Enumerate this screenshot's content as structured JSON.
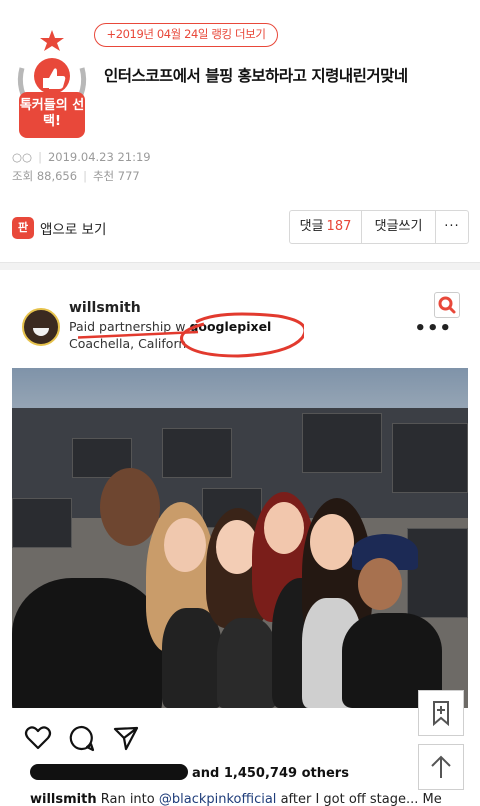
{
  "header": {
    "ranking_link": "+2019년 04월 24일 랭킹 더보기",
    "badge_label": "톡커들의 선택!",
    "title": "인터스코프에서 블핑 홍보하라고 지령내린거맞네"
  },
  "meta": {
    "date": "2019.04.23 21:19",
    "views_label": "조회",
    "views": "88,656",
    "recommend_label": "추천",
    "recommend": "777"
  },
  "toolbar": {
    "app_view_label": "앱으로 보기",
    "comment_label": "댓글",
    "comment_count": "187",
    "write_comment_label": "댓글쓰기",
    "more_label": "···"
  },
  "post": {
    "username": "willsmith",
    "partnership_prefix": "Paid partnership w",
    "partner": "googlepixel",
    "location": "Coachella, Californ",
    "more_label": "•••",
    "likes_suffix": "and 1,450,749 others",
    "caption_user": "willsmith",
    "caption_text_1": "Ran into",
    "caption_mention": "@blackpinkofficial",
    "caption_text_2": "after I got off stage... Me"
  },
  "icons": {
    "search": "search-icon",
    "heart": "heart-icon",
    "comment": "comment-icon",
    "share": "share-icon",
    "bookmark": "bookmark-icon",
    "scroll_top": "arrow-up-icon"
  },
  "colors": {
    "accent": "#e8483a",
    "mention": "#1f3d7a"
  }
}
